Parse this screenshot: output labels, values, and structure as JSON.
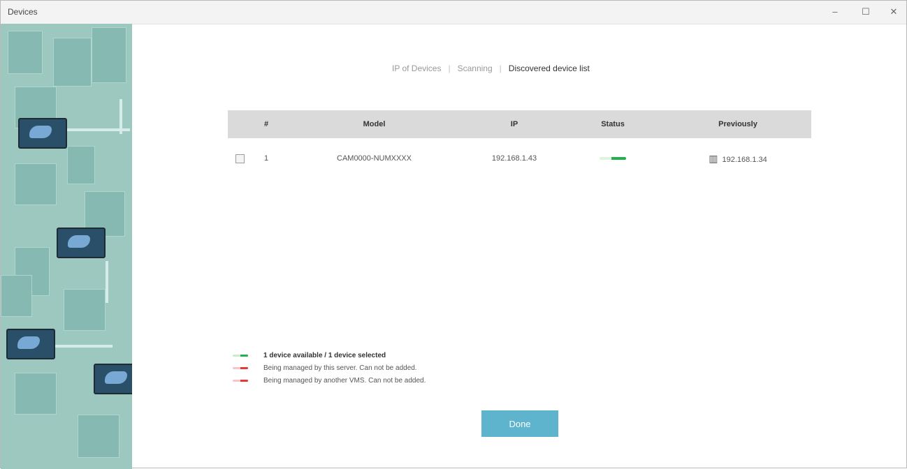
{
  "window": {
    "title": "Devices",
    "minimize_glyph": "–",
    "maximize_glyph": "☐",
    "close_glyph": "✕"
  },
  "steps": [
    {
      "label": "IP of Devices",
      "state": "done"
    },
    {
      "label": "Scanning",
      "state": "done"
    },
    {
      "label": "Discovered device list",
      "state": "active"
    }
  ],
  "table": {
    "headers": [
      "",
      "#",
      "Model",
      "IP",
      "Status",
      "Previously"
    ],
    "rows": [
      {
        "checked": false,
        "index": "1",
        "model": "CAM0000-NUMXXXX",
        "ip": "192.168.1.43",
        "status": "available",
        "previously": "192.168.1.34"
      }
    ]
  },
  "legend": [
    {
      "color": "green",
      "text": "1 device available / 1 device selected"
    },
    {
      "color": "red",
      "text": "Being managed by this server. Can not be added."
    },
    {
      "color": "red",
      "text": "Being managed by another VMS. Can not be added."
    }
  ],
  "done_label": "Done",
  "colors": {
    "accent": "#5eb4cc",
    "status_green": "#22b14c",
    "status_red": "#e53935",
    "header_bg": "#dadada"
  },
  "icons": {
    "previously": "server-icon"
  }
}
